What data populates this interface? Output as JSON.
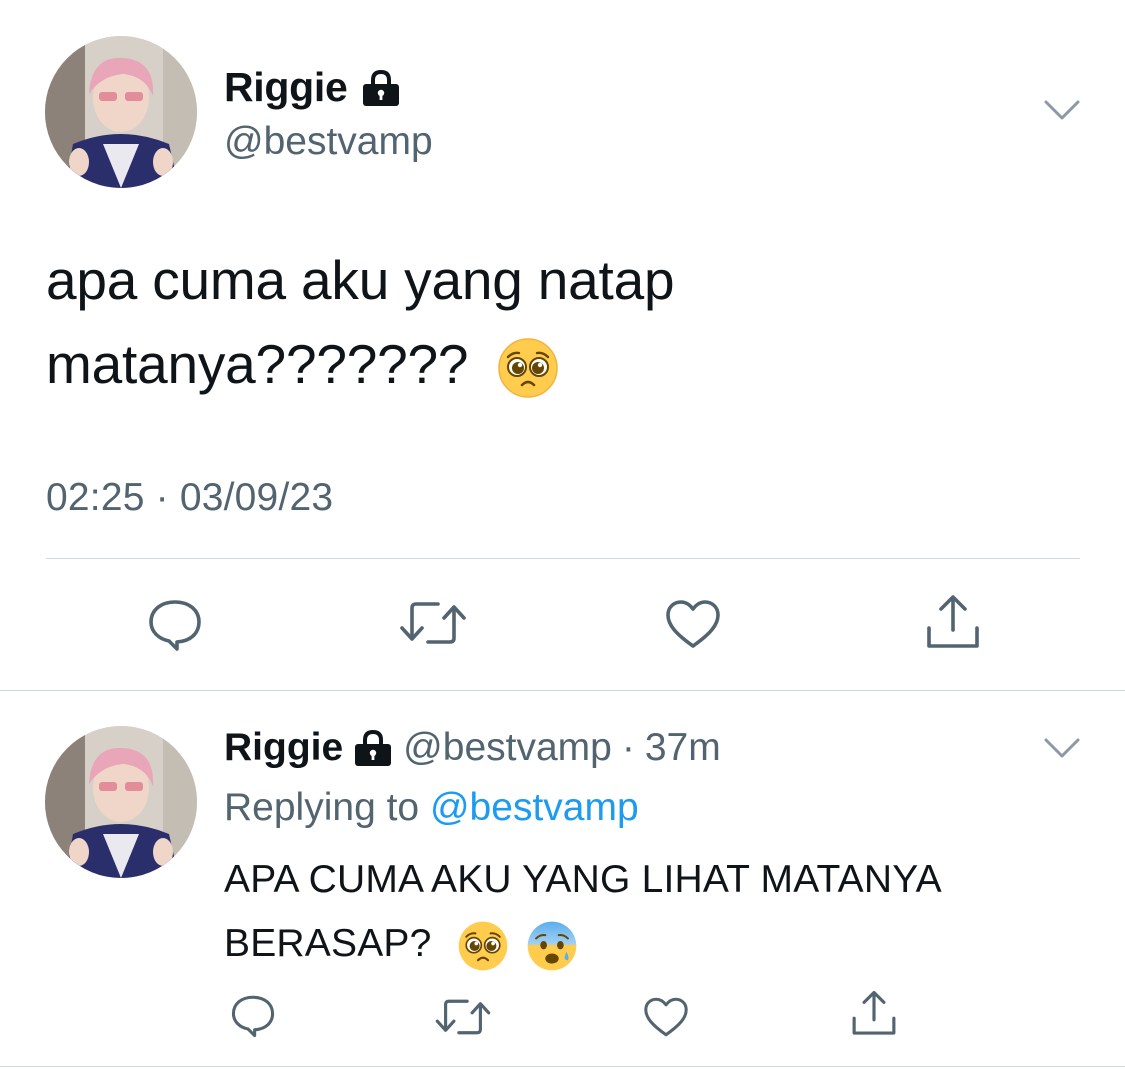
{
  "main_tweet": {
    "author": {
      "name": "Riggie",
      "handle": "@bestvamp",
      "protected_icon": "lock-icon",
      "avatar": "avatar-photo"
    },
    "text_line1": "apa cuma aku yang natap",
    "text_line2": "matanya???????",
    "emoji": "pleading-face-emoji",
    "timestamp": "02:25 · 03/09/23",
    "actions": [
      {
        "icon": "reply-icon"
      },
      {
        "icon": "retweet-icon"
      },
      {
        "icon": "like-icon"
      },
      {
        "icon": "share-icon"
      }
    ]
  },
  "reply_tweet": {
    "author": {
      "name": "Riggie",
      "handle": "@bestvamp",
      "protected_icon": "lock-icon"
    },
    "separator": "·",
    "time_ago": "37m",
    "replying_prefix": "Replying to",
    "replying_mention": "@bestvamp",
    "text_line1": "APA CUMA AKU YANG LIHAT MATANYA",
    "text_line2": "BERASAP?",
    "emojis": [
      "pleading-face-emoji",
      "anxious-face-emoji"
    ],
    "actions": [
      {
        "icon": "reply-icon"
      },
      {
        "icon": "retweet-icon"
      },
      {
        "icon": "like-icon"
      },
      {
        "icon": "share-icon"
      }
    ]
  },
  "colors": {
    "text_primary": "#0f1419",
    "text_secondary": "#536471",
    "link": "#1d9bf0",
    "divider": "#cfd9de"
  }
}
